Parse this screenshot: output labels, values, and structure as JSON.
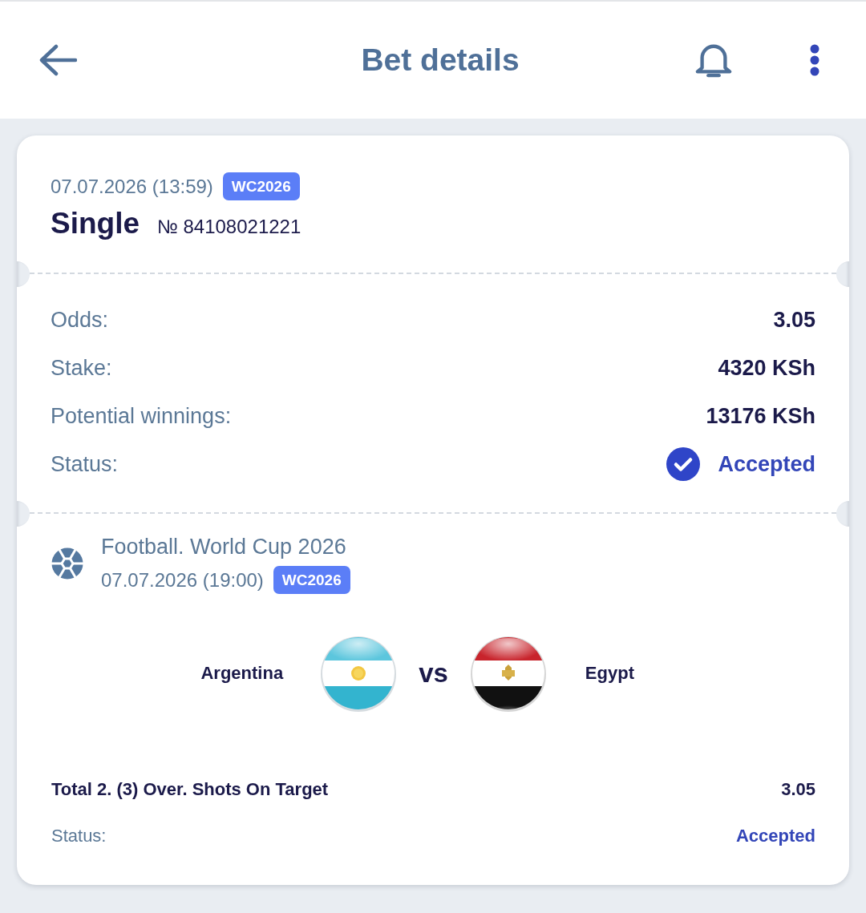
{
  "header": {
    "title": "Bet details"
  },
  "bet": {
    "date": "07.07.2026 (13:59)",
    "badge": "WC2026",
    "type": "Single",
    "number": "№ 84108021221"
  },
  "summary": [
    {
      "kind": "text",
      "label": "Odds:",
      "value": "3.05"
    },
    {
      "kind": "text",
      "label": "Stake:",
      "value": "4320 KSh"
    },
    {
      "kind": "text",
      "label": "Potential winnings:",
      "value": "13176 KSh"
    },
    {
      "kind": "status",
      "label": "Status:",
      "value": "Accepted"
    }
  ],
  "event": {
    "title": "Football. World Cup 2026",
    "date": "07.07.2026 (19:00)",
    "badge": "WC2026",
    "home": "Argentina",
    "separator": "vs",
    "away": "Egypt",
    "market": "Total 2. (3) Over. Shots On Target",
    "odds": "3.05",
    "status_label": "Status:",
    "status": "Accepted"
  }
}
